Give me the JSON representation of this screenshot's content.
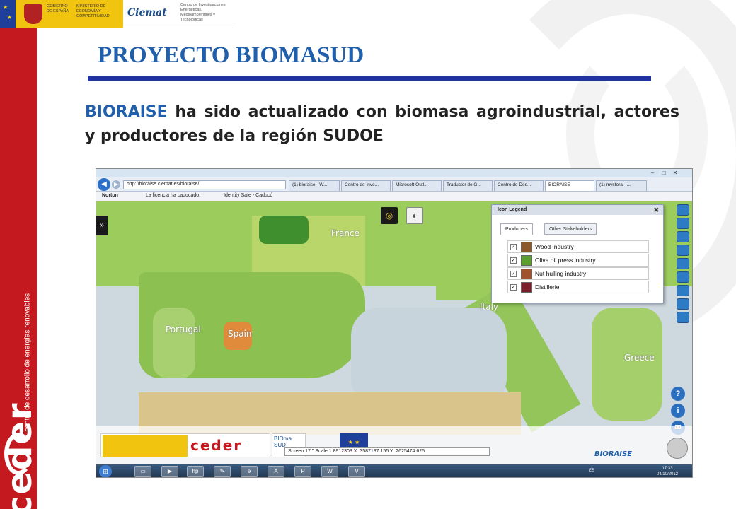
{
  "header": {
    "gov_text_1": "GOBIERNO DE ESPAÑA",
    "gov_text_2": "MINISTERIO DE ECONOMÍA Y COMPETITIVIDAD",
    "ciemat": "Ciemat",
    "ciemat_sub": "Centro de Investigaciones Energéticas, Medioambientales y Tecnológicas"
  },
  "sidebar": {
    "brand": "ceder",
    "sub": "centro de desarrollo de energías renovables"
  },
  "title": "PROYECTO BIOMASUD",
  "body": {
    "highlight": "BIORAISE",
    "text": " ha sido actualizado con biomasa agroindustrial, actores y productores de la región SUDOE"
  },
  "browser": {
    "address": "http://bioraise.ciemat.es/bioraise/",
    "tabs": [
      "(1) bioraise - W...",
      "Centro de Inve...",
      "Microsoft Outl...",
      "Traductor de G...",
      "Centro de Des...",
      "BIORAISE",
      "(1) mystora - ..."
    ],
    "active_tab_index": 5,
    "toolbar_items": [
      "Norton",
      "La licencia ha caducado.",
      "Identity Safe - Caducó"
    ]
  },
  "map": {
    "labels": [
      "France",
      "Portugal",
      "Spain",
      "Italy",
      "Greece"
    ],
    "legend": {
      "title": "Icon Legend",
      "tabs": [
        "Producers",
        "Other Stakeholders"
      ],
      "items": [
        {
          "label": "Wood Industry",
          "color": "#8b5a2b"
        },
        {
          "label": "Olive oil press industry",
          "color": "#5a9e2f"
        },
        {
          "label": "Nut hulling industry",
          "color": "#a0522d"
        },
        {
          "label": "Distillerie",
          "color": "#7a1f2b"
        }
      ]
    },
    "coord_bar": "Screen  17 \"   Scale 1:8912303   X: 3587187.155  Y: 2625474.625",
    "brand": "BIORAISE",
    "bioma": "BIOma SUD",
    "ceder": "ceder"
  },
  "taskbar": {
    "lang": "ES",
    "time": "17:33",
    "date": "04/10/2012"
  }
}
